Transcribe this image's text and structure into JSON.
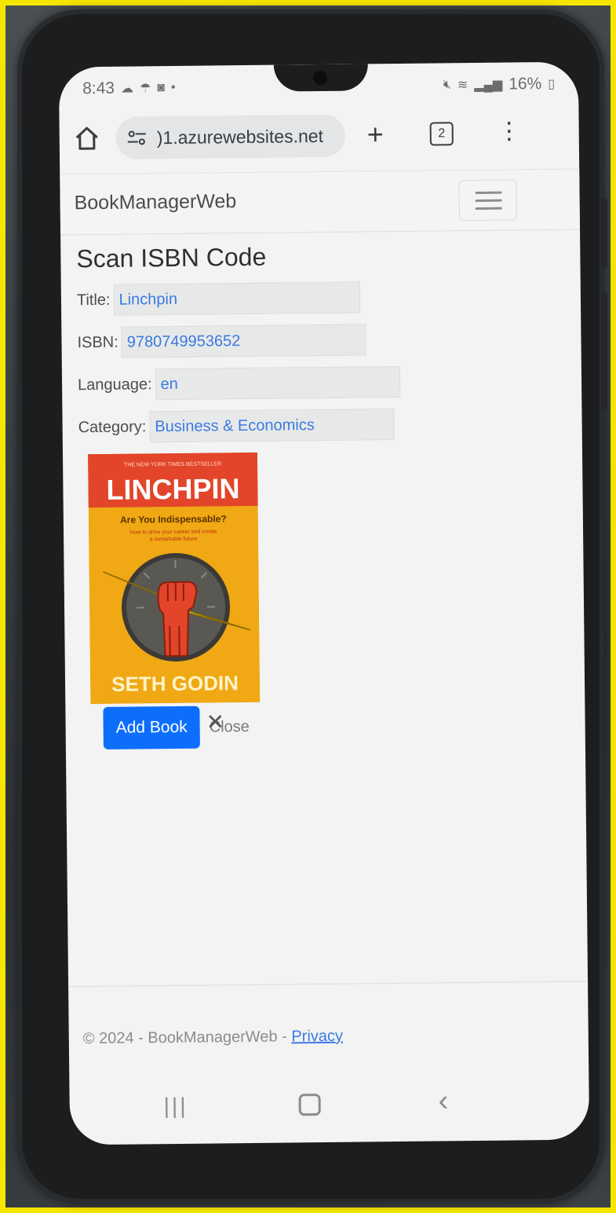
{
  "status_bar": {
    "time": "8:43",
    "battery": "16%",
    "left_icons": [
      "cloud-icon",
      "weather-icon",
      "instagram-icon",
      "dot-icon"
    ],
    "right_icons": [
      "mute-icon",
      "wifi-icon",
      "signal-icon",
      "battery-icon"
    ]
  },
  "browser": {
    "url": ")1.azurewebsites.net",
    "tab_count": "2",
    "new_tab_label": "+",
    "menu_label": "⋮"
  },
  "navbar": {
    "brand": "BookManagerWeb"
  },
  "page": {
    "title": "Scan ISBN Code",
    "fields": {
      "title_label": "Title:",
      "title_value": "Linchpin",
      "isbn_label": "ISBN:",
      "isbn_value": "9780749953652",
      "language_label": "Language:",
      "language_value": "en",
      "category_label": "Category:",
      "category_value": "Business & Economics"
    },
    "cover": {
      "banner": "THE NEW YORK TIMES BESTSELLER",
      "title": "LINCHPIN",
      "subtitle": "Are You Indispensable?",
      "tagline_line1": "How to drive your career and create",
      "tagline_line2": "a remarkable future",
      "author": "SETH GODIN"
    },
    "add_button": "Add Book",
    "close_button": "Close"
  },
  "footer": {
    "text": "© 2024 - BookManagerWeb - ",
    "privacy_link": "Privacy"
  },
  "colors": {
    "primary_button": "#0d6efd",
    "field_text": "#3a79e3",
    "frame": "#f5e600"
  }
}
